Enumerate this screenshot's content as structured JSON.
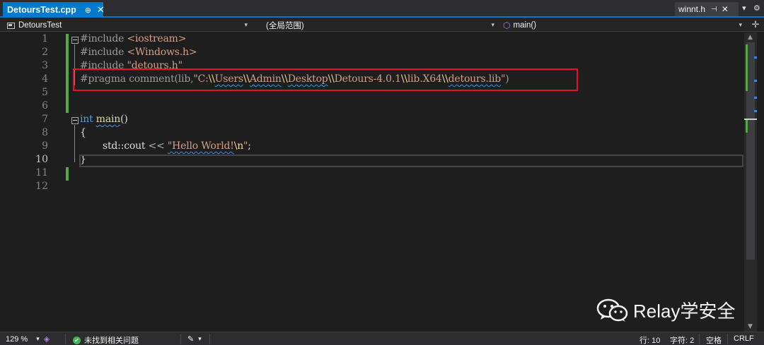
{
  "tabs": {
    "active": {
      "label": "DetoursTest.cpp",
      "pin_glyph": "⊕",
      "close_glyph": "✕"
    },
    "right": {
      "label": "winnt.h",
      "pin_glyph": "⊣",
      "close_glyph": "✕"
    },
    "tools": {
      "dropdown_glyph": "▾",
      "settings_glyph": "⚙"
    }
  },
  "navbar": {
    "project": "DetoursTest",
    "scope": "(全局范围)",
    "function": "main()",
    "dropdown_glyph": "▾",
    "split_glyph": "✛"
  },
  "editor": {
    "line_numbers": [
      "1",
      "2",
      "3",
      "4",
      "5",
      "6",
      "7",
      "8",
      "9",
      "10",
      "11",
      "12"
    ],
    "current_line": "10",
    "code": {
      "l1_directive": "#include ",
      "l1_header": "<iostream>",
      "l2_directive": "#include ",
      "l2_header": "<Windows.h>",
      "l3_directive": "#include ",
      "l3_header": "\"detours.h\"",
      "l4_directive": "#pragma comment(lib,",
      "l4_s1": "\"C:",
      "l4_e1": "\\\\",
      "l4_s2": "Users",
      "l4_e2": "\\\\",
      "l4_s3": "Admin",
      "l4_e3": "\\\\",
      "l4_s4": "Desktop",
      "l4_e4": "\\\\",
      "l4_s5": "Detours-4.0.1",
      "l4_e5": "\\\\",
      "l4_s6": "lib.X64",
      "l4_e6": "\\\\",
      "l4_s7": "detours.lib",
      "l4_s8": "\"",
      "l4_close": ")",
      "l7_kw": "int",
      "l7_fn": "main",
      "l7_rest": "()",
      "l8": "{",
      "l9_plain": "std::cout ",
      "l9_op": "<< ",
      "l9_s1": "\"Hello World!",
      "l9_esc": "\\n",
      "l9_s2": "\"",
      "l9_end": ";",
      "l10": "}"
    }
  },
  "watermark": {
    "text": "Relay学安全"
  },
  "statusbar": {
    "zoom": "129 %",
    "dropdown_glyph": "▾",
    "issues": "未找到相关问题",
    "row": "行: 10",
    "col": "字符: 2",
    "whitespace": "空格",
    "line_ending": "CRLF"
  },
  "colors": {
    "accent": "#007acc",
    "keyword": "#569cd6",
    "string": "#d69d85",
    "highlight_box": "#e81123",
    "change_bar": "#57a64a"
  }
}
